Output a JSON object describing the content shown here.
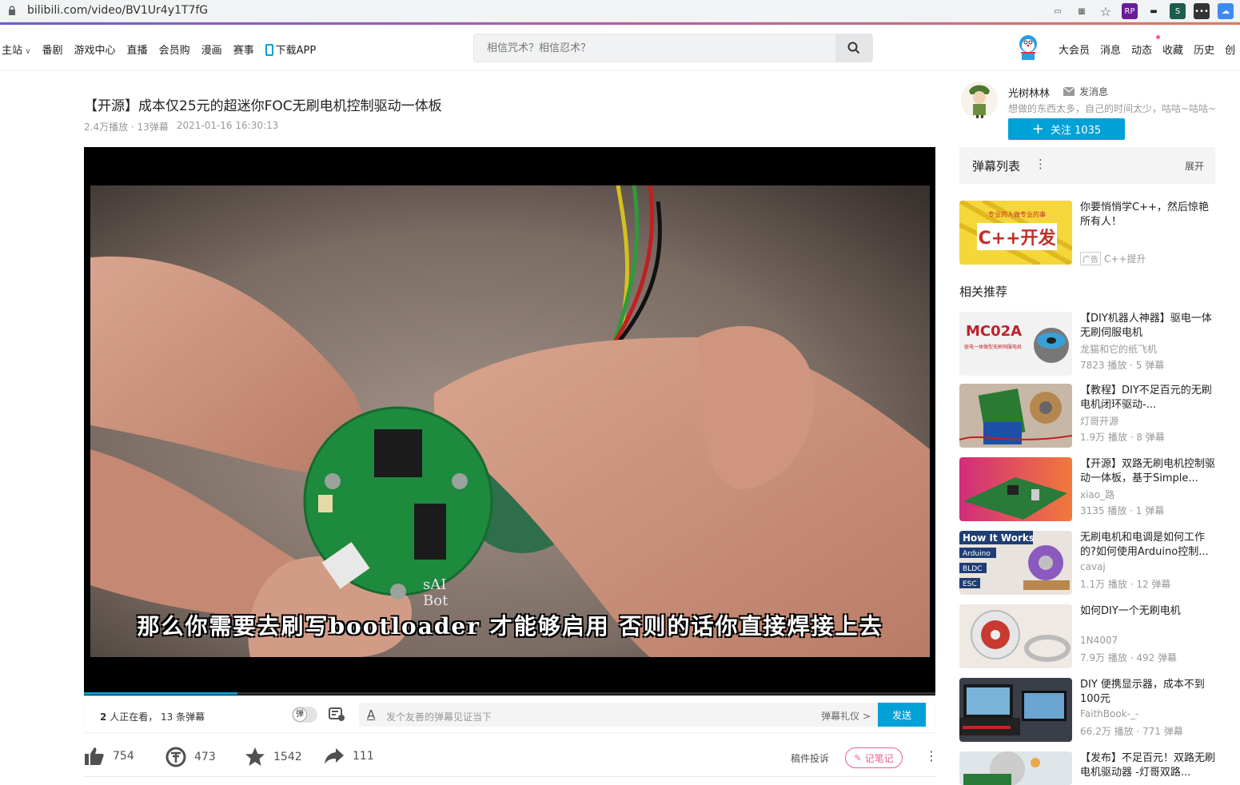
{
  "browser": {
    "url": "bilibili.com/video/BV1Ur4y1T7fG",
    "ext_labels": [
      "RP",
      "S"
    ]
  },
  "nav": {
    "items": [
      "主站",
      "番剧",
      "游戏中心",
      "直播",
      "会员购",
      "漫画",
      "赛事",
      "下载APP"
    ],
    "search_placeholder": "相信咒术？相信忍术？",
    "right_items": [
      "大会员",
      "消息",
      "动态",
      "收藏",
      "历史",
      "创"
    ]
  },
  "video": {
    "title": "【开源】成本仅25元的超迷你FOC无刷电机控制驱动一体板",
    "plays": "2.4万播放",
    "danmaku": "13弹幕",
    "date": "2021-01-16 16:30:13",
    "subtitle": "那么你需要去刷写bootloader 才能够启用 否则的话你直接焊接上去",
    "progress_pct": 18
  },
  "player_bar": {
    "viewers_count": "2",
    "viewers_text": "人正在看，",
    "danmaku_count": "13",
    "danmaku_text": "条弹幕",
    "toggle_label": "弹",
    "input_placeholder": "发个友善的弹幕见证当下",
    "gift_label": "弹幕礼仪 >",
    "send_label": "发送"
  },
  "actions": {
    "like": "754",
    "coin": "473",
    "favorite": "1542",
    "share": "111",
    "report": "稿件投诉",
    "note": "记笔记"
  },
  "uploader": {
    "name": "光树林林",
    "message": "发消息",
    "desc": "想做的东西太多，自己的时间太少，咕咕~咕咕~",
    "follow": "关注 1035"
  },
  "danmaku_panel": {
    "title": "弹幕列表",
    "expand": "展开"
  },
  "ad": {
    "title": "你要悄悄学C++，然后惊艳所有人！",
    "tag": "广告",
    "source": "C++提升",
    "thumb_top": "专业的人做专业的事",
    "thumb_main": "C++开发"
  },
  "recommend_title": "相关推荐",
  "recommendations": [
    {
      "title": "【DIY机器人神器】驱电一体无刷伺服电机",
      "author": "龙猫和它的纸飞机",
      "stats": "7823 播放 · 5 弹幕",
      "thumb_text": "MC02A",
      "thumb_sub": "驱电一体微型无刷伺服电机"
    },
    {
      "title": "【教程】DIY不足百元的无刷电机闭环驱动-...",
      "author": "灯哥开源",
      "stats": "1.9万 播放 · 8 弹幕"
    },
    {
      "title": "【开源】双路无刷电机控制驱动一体板，基于Simple...",
      "author": "xiao_路",
      "stats": "3135 播放 · 1 弹幕"
    },
    {
      "title": "无刷电机和电调是如何工作的?如何使用Arduino控制...",
      "author": "cavaj",
      "stats": "1.1万 播放 · 12 弹幕",
      "thumb_text": "How It Works",
      "thumb_tags": [
        "Arduino",
        "BLDC",
        "ESC"
      ]
    },
    {
      "title": "如何DIY一个无刷电机",
      "author": "1N4007",
      "stats": "7.9万 播放 · 492 弹幕"
    },
    {
      "title": "DIY 便携显示器，成本不到100元",
      "author": "FaithBook-_-",
      "stats": "66.2万 播放 · 771 弹幕"
    },
    {
      "title": "【发布】不足百元！双路无刷电机驱动器 -灯哥双路...",
      "author": "",
      "stats": ""
    }
  ],
  "colors": {
    "accent": "#00a1d6",
    "pink": "#f25d8e"
  }
}
